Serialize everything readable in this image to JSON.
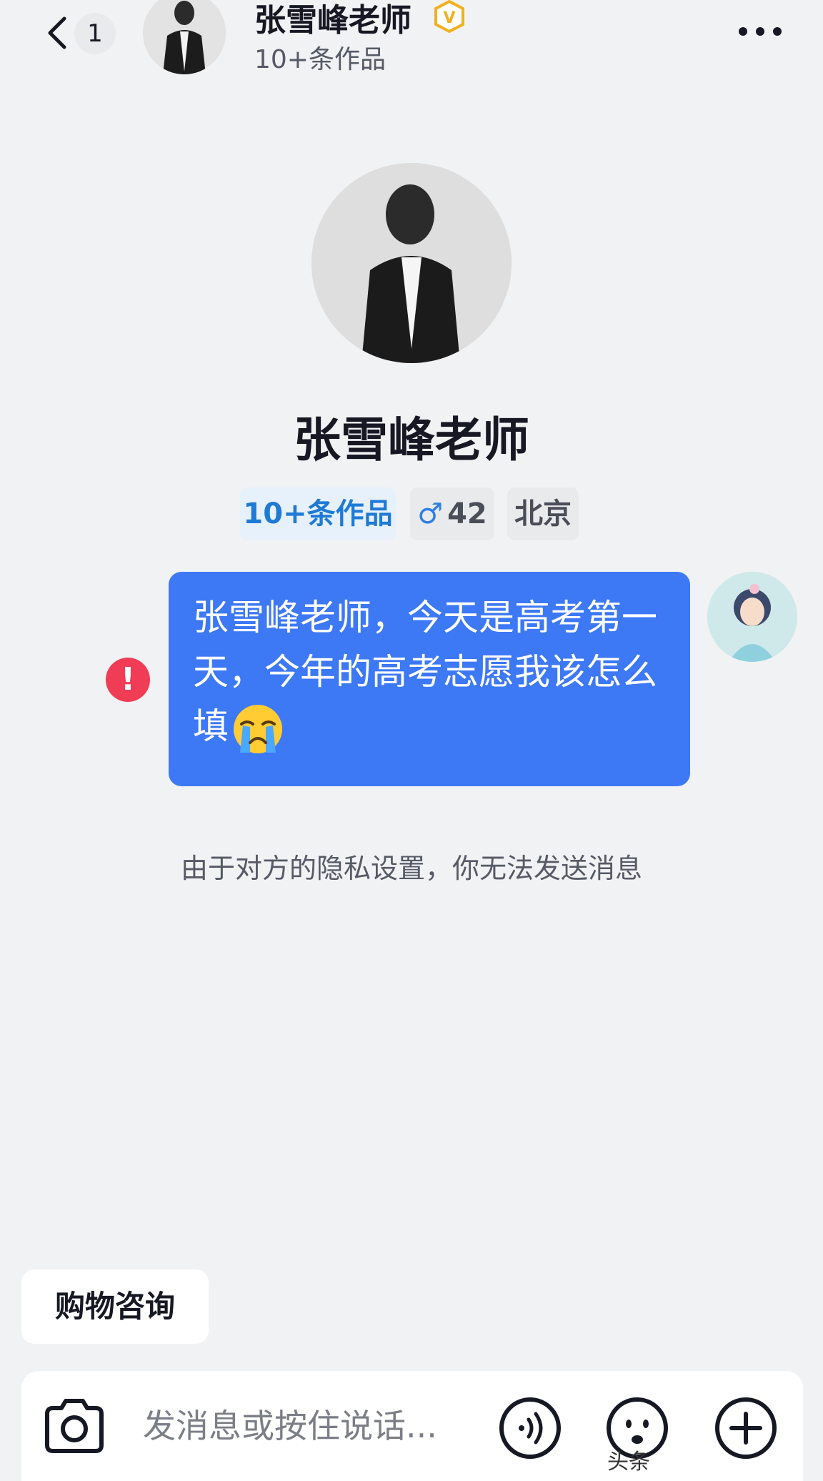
{
  "header": {
    "unread_count": "1",
    "name": "张雪峰老师",
    "subtitle": "10+条作品",
    "verified_icon": "verified-v-icon"
  },
  "profile": {
    "name": "张雪峰老师",
    "tags": {
      "works": "10+条作品",
      "gender_symbol": "♂",
      "age": "42",
      "city": "北京"
    }
  },
  "conversation": {
    "messages": [
      {
        "from": "me",
        "text": "张雪峰老师，今天是高考第一天，今年的高考志愿我该怎么填",
        "emoji": "crying-face",
        "status": "failed"
      }
    ],
    "system_notice": "由于对方的隐私设置，你无法发送消息"
  },
  "bottom": {
    "quick_reply": "购物咨询",
    "input_placeholder": "发消息或按住说话...",
    "watermark": "头条"
  },
  "colors": {
    "bubble": "#3d78f5",
    "error": "#f13c55",
    "works_tag_text": "#1f7ad6",
    "background": "#f1f2f4"
  }
}
